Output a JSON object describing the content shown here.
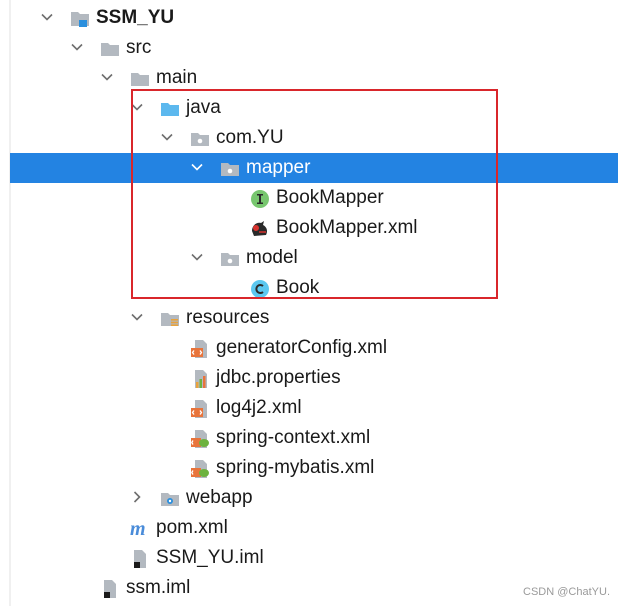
{
  "tree": {
    "items": [
      {
        "name": "SSM_YU",
        "depth": 0,
        "expanded": true,
        "icon": "module-folder-icon",
        "bold": true
      },
      {
        "name": "src",
        "depth": 1,
        "expanded": true,
        "icon": "folder-icon"
      },
      {
        "name": "main",
        "depth": 2,
        "expanded": true,
        "icon": "folder-icon"
      },
      {
        "name": "java",
        "depth": 3,
        "expanded": true,
        "icon": "source-root-folder-icon"
      },
      {
        "name": "com.YU",
        "depth": 4,
        "expanded": true,
        "icon": "package-icon"
      },
      {
        "name": "mapper",
        "depth": 5,
        "expanded": true,
        "icon": "package-icon",
        "selected": true
      },
      {
        "name": "BookMapper",
        "depth": 6,
        "icon": "interface-icon"
      },
      {
        "name": "BookMapper.xml",
        "depth": 6,
        "icon": "mybatis-xml-icon"
      },
      {
        "name": "model",
        "depth": 5,
        "expanded": true,
        "icon": "package-icon"
      },
      {
        "name": "Book",
        "depth": 6,
        "icon": "class-icon"
      },
      {
        "name": "resources",
        "depth": 3,
        "expanded": true,
        "icon": "resources-folder-icon"
      },
      {
        "name": "generatorConfig.xml",
        "depth": 4,
        "icon": "xml-file-icon"
      },
      {
        "name": "jdbc.properties",
        "depth": 4,
        "icon": "properties-file-icon"
      },
      {
        "name": "log4j2.xml",
        "depth": 4,
        "icon": "xml-file-icon"
      },
      {
        "name": "spring-context.xml",
        "depth": 4,
        "icon": "spring-xml-icon"
      },
      {
        "name": "spring-mybatis.xml",
        "depth": 4,
        "icon": "spring-xml-icon"
      },
      {
        "name": "webapp",
        "depth": 3,
        "expanded": false,
        "icon": "web-folder-icon"
      },
      {
        "name": "pom.xml",
        "depth": 2,
        "icon": "maven-icon"
      },
      {
        "name": "SSM_YU.iml",
        "depth": 2,
        "icon": "iml-file-icon"
      },
      {
        "name": "ssm.iml",
        "depth": 1,
        "icon": "iml-file-icon"
      }
    ]
  },
  "watermark": "CSDN @ChatYU.",
  "colors": {
    "selection": "#2383e2",
    "highlight_box": "#d9262b"
  }
}
